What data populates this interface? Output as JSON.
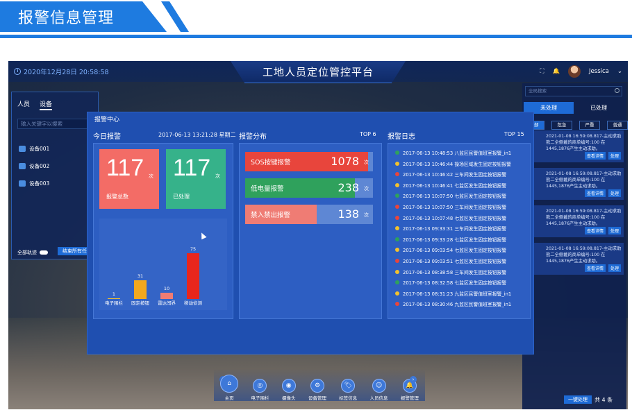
{
  "header": {
    "title": "报警信息管理"
  },
  "topbar": {
    "datetime": "2020年12月28日 20:58:58",
    "platform_title": "工地人员定位管控平台",
    "user": "Jessica"
  },
  "left_panel": {
    "tabs": [
      "人员",
      "设备"
    ],
    "search_placeholder": "输入关键字以搜索",
    "devices": [
      "设备001",
      "设备002",
      "设备003"
    ],
    "all_tracks": "全部轨迹",
    "end_all_button": "结束所有任务"
  },
  "right_panel": {
    "search_placeholder": "全局搜索",
    "tabs": [
      "未处理",
      "已处理"
    ],
    "filters": [
      "全部",
      "危急",
      "严重",
      "普通"
    ],
    "cards": [
      {
        "tag": "危急",
        "color": "#e0433a",
        "text": "2021-01-08 16:59:08.817-主动求助 熊二全侧戴的商单编号:100 在1445,1876产生主动求助。"
      },
      {
        "tag": "普通",
        "color": "#2e9d5a",
        "text": "2021-01-08 16:59:08.817-主动求助 熊二全侧戴的商单编号:100 在1445,1876产生主动求助。"
      },
      {
        "tag": "严重",
        "color": "#e07a2e",
        "text": "2021-01-08 16:59:08.817-主动求助 熊二全侧戴的商单编号:100 在1445,1876产生主动求助。"
      },
      {
        "tag": "危急",
        "color": "#2e9d5a",
        "text": "2021-01-08 16:59:08.817-主动求助 熊二全侧戴的商单编号:100 在1445,1876产生主动求助。"
      }
    ],
    "card_btn_detail": "查看详情",
    "card_btn_handle": "处理",
    "bulk_button": "一键处理",
    "total": "共 4 条"
  },
  "dock": [
    "主页",
    "电子围栏",
    "摄像头",
    "设备管理",
    "标签信息",
    "人员信息",
    "报警管理"
  ],
  "alarm": {
    "title": "报警中心",
    "today": {
      "title": "今日报警",
      "datetime": "2017-06-13 13:21:28 星期二",
      "total": "117",
      "total_unit": "次",
      "total_label": "报警总数",
      "handled": "117",
      "handled_unit": "次",
      "handled_label": "已处理"
    },
    "distribution": {
      "title": "报警分布",
      "top": "TOP 6",
      "unit": "次",
      "items": [
        {
          "name": "SOS按键报警",
          "value": "1078",
          "frac": 0.96,
          "color": "#e8453c"
        },
        {
          "name": "低电量报警",
          "value": "238",
          "frac": 0.86,
          "color": "#2fa15c"
        },
        {
          "name": "禁入禁出报警",
          "value": "138",
          "frac": 0.56,
          "color": "#ef7c74"
        }
      ]
    },
    "log": {
      "title": "报警日志",
      "top": "TOP 15",
      "entries": [
        {
          "text": "2017-06-13 10:48:53  八监区民警值班室报警_in1",
          "color": "#2fa15c"
        },
        {
          "text": "2017-06-13 10:46:44  操场区域发生固定按钮报警",
          "color": "#f2c12e"
        },
        {
          "text": "2017-06-13 10:46:42  三车间发生固定按钮报警",
          "color": "#e8453c"
        },
        {
          "text": "2017-06-13 10:46:41  七监区发生固定按钮报警",
          "color": "#f2c12e"
        },
        {
          "text": "2017-06-13 10:07:50  七监区发生固定按钮报警",
          "color": "#2fa15c"
        },
        {
          "text": "2017-06-13 10:07:50  三车间发生固定按钮报警",
          "color": "#e8453c"
        },
        {
          "text": "2017-06-13 10:07:48  七监区发生固定按钮报警",
          "color": "#e8453c"
        },
        {
          "text": "2017-06-13 09:33:31  三车间发生固定按钮报警",
          "color": "#f2c12e"
        },
        {
          "text": "2017-06-13 09:33:28  七监区发生固定按钮报警",
          "color": "#2fa15c"
        },
        {
          "text": "2017-06-13 09:03:54  七监区发生固定按钮报警",
          "color": "#f2c12e"
        },
        {
          "text": "2017-06-13 09:03:51  七监区发生固定按钮报警",
          "color": "#e8453c"
        },
        {
          "text": "2017-06-13 08:38:58  三车间发生固定按钮报警",
          "color": "#f2c12e"
        },
        {
          "text": "2017-06-13 08:32:58  七监区发生固定按钮报警",
          "color": "#2fa15c"
        },
        {
          "text": "2017-06-13 08:31:23  九监区民警值班室报警_in1",
          "color": "#f2c12e"
        },
        {
          "text": "2017-06-13 08:30:46  九监区民警值班室报警_in1",
          "color": "#e8453c"
        }
      ]
    }
  },
  "chart_data": {
    "type": "bar",
    "categories": [
      "电子围栏",
      "固定按钮",
      "雷达闯界",
      "移动侦测"
    ],
    "values": [
      1,
      31,
      10,
      75
    ],
    "colors": [
      "#f2c12e",
      "#f2a81e",
      "#ef7c74",
      "#e8261c"
    ]
  }
}
